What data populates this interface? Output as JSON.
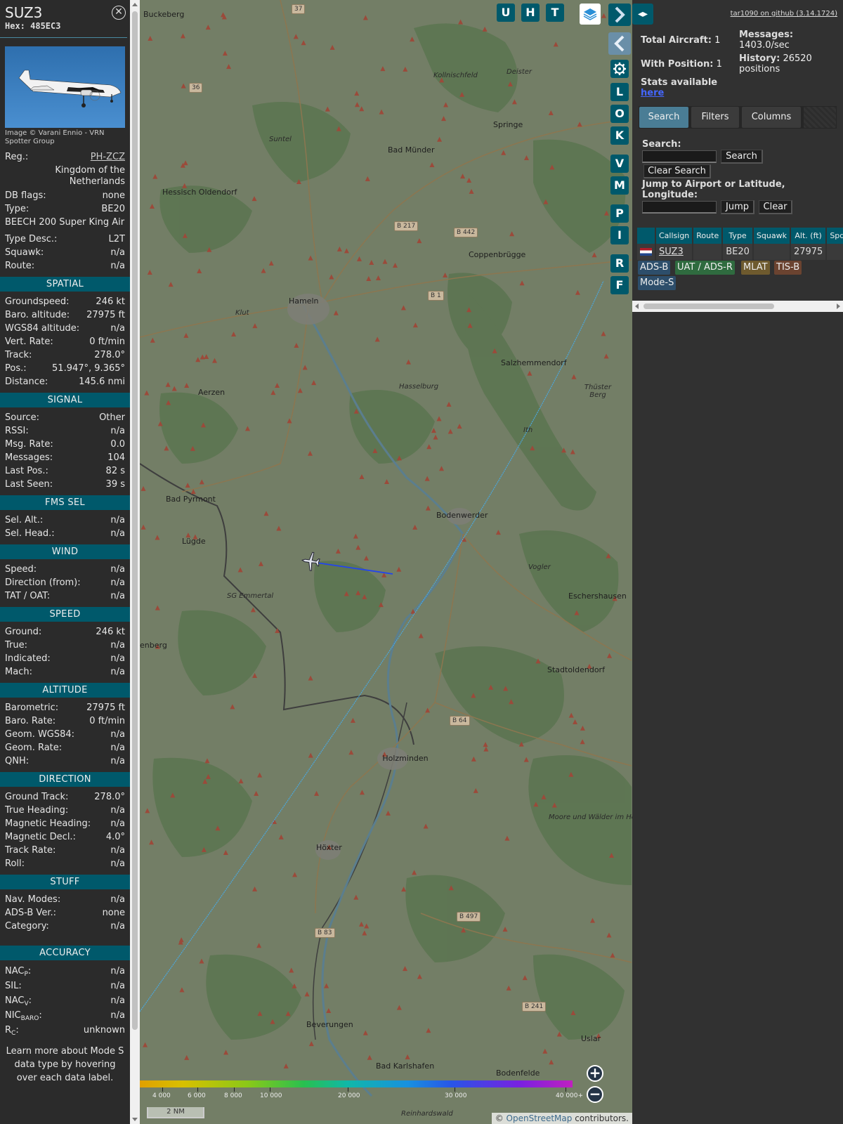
{
  "info": {
    "callsign": "SUZ3",
    "hex": "Hex: 485EC3",
    "photo_credit": "Image © Varani Ennio - VRN Spotter Group",
    "top_rows": [
      {
        "label": "Reg.:",
        "value": "PH-ZCZ"
      },
      {
        "label": "Kingdom of the Netherlands"
      },
      {
        "label": "DB flags:",
        "value": "none"
      },
      {
        "label": "Type:",
        "value": "BE20"
      },
      {
        "label": "BEECH 200 Super King Air"
      },
      {
        "label": "Type Desc.:",
        "value": "L2T"
      },
      {
        "label": "Squawk:",
        "value": "n/a"
      },
      {
        "label": "Route:",
        "value": "n/a"
      }
    ],
    "sections": [
      {
        "title": "SPATIAL",
        "rows": [
          {
            "label": "Groundspeed:",
            "value": "246 kt"
          },
          {
            "label": "Baro. altitude:",
            "value": "27975 ft"
          },
          {
            "label": "WGS84 altitude:",
            "value": "n/a"
          },
          {
            "label": "Vert. Rate:",
            "value": "0 ft/min"
          },
          {
            "label": "Track:",
            "value": "278.0°"
          },
          {
            "label": "Pos.:",
            "value": "51.947°, 9.365°"
          },
          {
            "label": "Distance:",
            "value": "145.6 nmi"
          }
        ]
      },
      {
        "title": "SIGNAL",
        "rows": [
          {
            "label": "Source:",
            "value": "Other"
          },
          {
            "label": "RSSI:",
            "value": "n/a"
          },
          {
            "label": "Msg. Rate:",
            "value": "0.0"
          },
          {
            "label": "Messages:",
            "value": "104"
          },
          {
            "label": "Last Pos.:",
            "value": "82 s"
          },
          {
            "label": "Last Seen:",
            "value": "39 s"
          }
        ]
      },
      {
        "title": "FMS SEL",
        "rows": [
          {
            "label": "Sel. Alt.:",
            "value": "n/a"
          },
          {
            "label": "Sel. Head.:",
            "value": "n/a"
          }
        ]
      },
      {
        "title": "WIND",
        "rows": [
          {
            "label": "Speed:",
            "value": "n/a"
          },
          {
            "label": "Direction (from):",
            "value": "n/a"
          },
          {
            "label": "TAT / OAT:",
            "value": "n/a"
          }
        ]
      },
      {
        "title": "SPEED",
        "rows": [
          {
            "label": "Ground:",
            "value": "246 kt"
          },
          {
            "label": "True:",
            "value": "n/a"
          },
          {
            "label": "Indicated:",
            "value": "n/a"
          },
          {
            "label": "Mach:",
            "value": "n/a"
          }
        ]
      },
      {
        "title": "ALTITUDE",
        "rows": [
          {
            "label": "Barometric:",
            "value": "27975 ft"
          },
          {
            "label": "Baro. Rate:",
            "value": "0 ft/min"
          },
          {
            "label": "Geom. WGS84:",
            "value": "n/a"
          },
          {
            "label": "Geom. Rate:",
            "value": "n/a"
          },
          {
            "label": "QNH:",
            "value": "n/a"
          }
        ]
      },
      {
        "title": "DIRECTION",
        "rows": [
          {
            "label": "Ground Track:",
            "value": "278.0°"
          },
          {
            "label": "True Heading:",
            "value": "n/a"
          },
          {
            "label": "Magnetic Heading:",
            "value": "n/a"
          },
          {
            "label": "Magnetic Decl.:",
            "value": "4.0°"
          },
          {
            "label": "Track Rate:",
            "value": "n/a"
          },
          {
            "label": "Roll:",
            "value": "n/a"
          }
        ]
      },
      {
        "title": "STUFF",
        "rows": [
          {
            "label": "Nav. Modes:",
            "value": "n/a"
          },
          {
            "label": "ADS-B Ver.:",
            "value": "none"
          },
          {
            "label": "Category:",
            "value": "n/a"
          }
        ]
      }
    ],
    "accuracy": {
      "title": "ACCURACY",
      "rows": [
        {
          "base": "NAC",
          "sub": "P",
          "suffix": ":",
          "value": "n/a"
        },
        {
          "base": "SIL:",
          "sub": "",
          "suffix": "",
          "value": "n/a"
        },
        {
          "base": "NAC",
          "sub": "V",
          "suffix": ":",
          "value": "n/a"
        },
        {
          "base": "NIC",
          "sub": "BARO",
          "suffix": ":",
          "value": "n/a"
        },
        {
          "base": "R",
          "sub": "C",
          "suffix": ":",
          "value": "unknown"
        }
      ]
    },
    "footer": "Learn more about Mode S data type by hovering over each data label.",
    "close_icon": "close-circle-icon"
  },
  "map": {
    "top_buttons": [
      "U",
      "H",
      "T"
    ],
    "side_buttons": [
      "L",
      "O",
      "K",
      "V",
      "M",
      "P",
      "I",
      "R",
      "F"
    ],
    "icons": {
      "layers": "layers-icon",
      "settings": "gear-icon",
      "next": "chevron-right-icon",
      "prev": "chevron-left-icon",
      "aircraft": "aircraft-icon",
      "zoom_in": "plus-icon",
      "zoom_out": "minus-icon"
    },
    "places": [
      {
        "name": "Buckeberg",
        "style": ""
      },
      {
        "name": "Kollnischfeld",
        "style": "ital"
      },
      {
        "name": "Deister",
        "style": "ital"
      },
      {
        "name": "Springe",
        "style": ""
      },
      {
        "name": "Suntel",
        "style": "ital"
      },
      {
        "name": "Bad Münder",
        "style": ""
      },
      {
        "name": "Hessisch Oldendorf",
        "style": ""
      },
      {
        "name": "Coppenbrügge",
        "style": ""
      },
      {
        "name": "Hameln",
        "style": ""
      },
      {
        "name": "Klut",
        "style": "ital"
      },
      {
        "name": "Salzhemmendorf",
        "style": ""
      },
      {
        "name": "Aerzen",
        "style": ""
      },
      {
        "name": "Hasselburg",
        "style": "ital"
      },
      {
        "name": "Thüster Berg",
        "style": "ital"
      },
      {
        "name": "Ith",
        "style": "ital"
      },
      {
        "name": "Bad Pyrmont",
        "style": ""
      },
      {
        "name": "Bodenwerder",
        "style": ""
      },
      {
        "name": "Lügde",
        "style": ""
      },
      {
        "name": "Vogler",
        "style": "ital"
      },
      {
        "name": "Eschershausen",
        "style": ""
      },
      {
        "name": "SG Emmertal",
        "style": "ital"
      },
      {
        "name": "Stadtoldendorf",
        "style": ""
      },
      {
        "name": "enberg",
        "style": ""
      },
      {
        "name": "Holzminden",
        "style": ""
      },
      {
        "name": "Moore und Wälder im Hochsolling",
        "style": "ital"
      },
      {
        "name": "Höxter",
        "style": ""
      },
      {
        "name": "Beverungen",
        "style": ""
      },
      {
        "name": "Uslar",
        "style": ""
      },
      {
        "name": "Bad Karlshafen",
        "style": ""
      },
      {
        "name": "Bodenfelde",
        "style": ""
      },
      {
        "name": "Reinhardswald",
        "style": "ital"
      }
    ],
    "roads": [
      "B 217",
      "B 442",
      "B 1",
      "B 64",
      "B 497",
      "B 83",
      "B 241",
      "37",
      "36"
    ],
    "altitude_scale": [
      "4 000",
      "6 000",
      "8 000",
      "10 000",
      "20 000",
      "30 000",
      "40 000+"
    ],
    "scale": "2 NM",
    "attribution_prefix": "© ",
    "attribution_link": "OpenStreetMap",
    "attribution_suffix": " contributors."
  },
  "sidebar": {
    "version": "tar1090 on github (3.14.1724)",
    "total_aircraft_label": "Total Aircraft:",
    "total_aircraft": "1",
    "with_position_label": "With Position:",
    "with_position": "1",
    "messages_label": "Messages:",
    "messages_value": "1403.0/sec",
    "history_label": "History:",
    "history_value": "26520 positions",
    "stats_label": "Stats available",
    "stats_link": "here",
    "tabs": [
      "Search",
      "Filters",
      "Columns"
    ],
    "search_label": "Search:",
    "search_button": "Search",
    "clear_search_button": "Clear Search",
    "jump_label": "Jump to Airport or Latitude, Longitude:",
    "jump_button": "Jump",
    "clear_button": "Clear",
    "table": {
      "columns": [
        "",
        "Callsign",
        "Route",
        "Type",
        "Squawk",
        "Alt. (ft)",
        "Spd."
      ],
      "rows": [
        {
          "callsign": "SUZ3",
          "route": "",
          "type": "BE20",
          "squawk": "",
          "alt": "27975",
          "spd": ""
        }
      ]
    },
    "chips": [
      {
        "label": "ADS-B",
        "color": "#2d4e6b"
      },
      {
        "label": "UAT / ADS-R",
        "color": "#2f6b3f"
      },
      {
        "label": "MLAT",
        "color": "#6e5a2e"
      },
      {
        "label": "TIS-B",
        "color": "#6b4330"
      },
      {
        "label": "Mode-S",
        "color": "#2d4e6b"
      }
    ]
  },
  "colors": {
    "accent": "#00596b",
    "track": "#2244ee",
    "trace": "#4aa8e0"
  }
}
